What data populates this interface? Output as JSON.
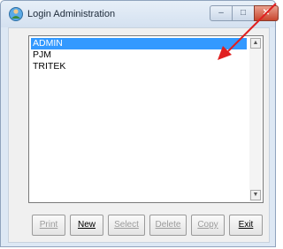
{
  "window": {
    "title": "Login Administration",
    "controls": {
      "minimize": "–",
      "maximize": "□",
      "close": "✕"
    }
  },
  "list": {
    "items": [
      {
        "label": "ADMIN",
        "selected": true
      },
      {
        "label": "PJM",
        "selected": false
      },
      {
        "label": "TRITEK",
        "selected": false
      }
    ],
    "scroll_up": "▲",
    "scroll_down": "▼"
  },
  "buttons": [
    {
      "label": "Print",
      "enabled": false
    },
    {
      "label": "New",
      "enabled": true
    },
    {
      "label": "Select",
      "enabled": false
    },
    {
      "label": "Delete",
      "enabled": false
    },
    {
      "label": "Copy",
      "enabled": false
    },
    {
      "label": "Exit",
      "enabled": true
    }
  ],
  "annotation": {
    "arrow_color": "#e02020"
  },
  "colors": {
    "selection": "#3399ff",
    "titlebar": "#dbe6f3"
  }
}
